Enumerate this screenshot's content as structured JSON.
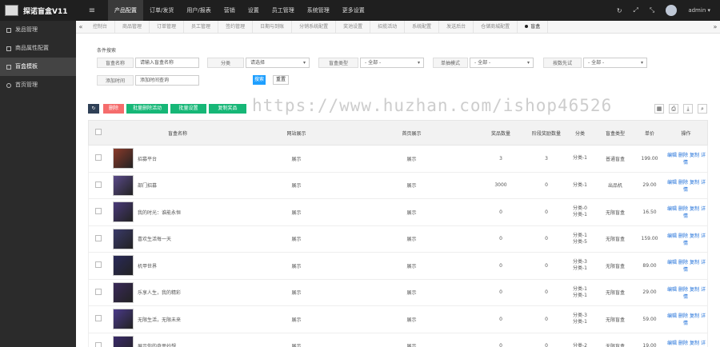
{
  "app": {
    "logo_text": "探诺盲盒V11"
  },
  "topnav": {
    "menu_toggle": "≡",
    "items": [
      "产品配置",
      "订单/发货",
      "用户/报表",
      "营销",
      "设置",
      "员工管理",
      "系统管理",
      "更多设置"
    ],
    "active_index": 0,
    "right_icons": {
      "refresh": "↻",
      "fullscreen_a": "⤢",
      "fullscreen_b": "⤡"
    },
    "user": "admin ▾"
  },
  "sidebar": {
    "items": [
      "发品管理",
      "商品属性配置",
      "盲盒模板",
      "首页管理"
    ],
    "active_index": 2
  },
  "tabs": {
    "left_arrow": "«",
    "right_arrow": "»",
    "items": [
      "控制台",
      "商品管理",
      "订单管理",
      "员工管理",
      "签约管理",
      "日期与到账",
      "分销系统配置",
      "奖池设置",
      "招揽活动",
      "系统配置",
      "发送后台",
      "仓储商城配置",
      "盲盒"
    ],
    "active_index": 12
  },
  "filter": {
    "title": "条件搜索",
    "fields": [
      {
        "label": "盲盒名称",
        "placeholder": "请输入盲盒名称"
      },
      {
        "label": "分类",
        "value": "请选择"
      },
      {
        "label": "盲盒类型",
        "value": "- 全部 -"
      },
      {
        "label": "单抽模式",
        "value": "- 全部 -"
      },
      {
        "label": "按数先试",
        "value": "- 全部 -"
      },
      {
        "label": "添加时间",
        "placeholder": "添加时间查询"
      }
    ],
    "search_label": "搜索",
    "reset_label": "重置"
  },
  "toolbar": {
    "refresh": "↻",
    "delete": "删除",
    "btn1": "批量删除活动",
    "btn2": "批量设置",
    "btn3": "复制奖品"
  },
  "tools": [
    "▦",
    "⎙",
    "⤓",
    "⌕"
  ],
  "table": {
    "headers": [
      "盲盒名称",
      "网站展示",
      "首页展示",
      "奖品数量",
      "阶段奖励数量",
      "分类",
      "盲盒类型",
      "单价",
      "操作"
    ],
    "rows": [
      {
        "name": "招募平台",
        "web": "展示",
        "front": "展示",
        "count": "3",
        "step": "3",
        "cat": [
          "分类-1"
        ],
        "type": "普通盲盒",
        "price": "199.00",
        "thumb": "#8b3a2a"
      },
      {
        "name": "部门招募",
        "web": "展示",
        "front": "展示",
        "count": "3000",
        "step": "0",
        "cat": [
          "分类-1"
        ],
        "type": "出品机",
        "price": "29.00",
        "thumb": "#5a4a8a"
      },
      {
        "name": "我的时光：谁能永恒",
        "web": "展示",
        "front": "展示",
        "count": "0",
        "step": "0",
        "cat": [
          "分类-0",
          "分类-1"
        ],
        "type": "无限盲盒",
        "price": "16.50",
        "thumb": "#4a3a7a"
      },
      {
        "name": "喜欢生活每一天",
        "web": "展示",
        "front": "展示",
        "count": "0",
        "step": "0",
        "cat": [
          "分类-1",
          "分类-5"
        ],
        "type": "无限盲盒",
        "price": "159.00",
        "thumb": "#3a3a6a"
      },
      {
        "name": "机甲世界",
        "web": "展示",
        "front": "展示",
        "count": "0",
        "step": "0",
        "cat": [
          "分类-3",
          "分类-1"
        ],
        "type": "无限盲盒",
        "price": "89.00",
        "thumb": "#2a2a5a"
      },
      {
        "name": "乐享人生，我的精彩",
        "web": "展示",
        "front": "展示",
        "count": "0",
        "step": "0",
        "cat": [
          "分类-1",
          "分类-1"
        ],
        "type": "无限盲盒",
        "price": "29.00",
        "thumb": "#3a2a5a"
      },
      {
        "name": "无限生活，无限未来",
        "web": "展示",
        "front": "展示",
        "count": "0",
        "step": "0",
        "cat": [
          "分类-3",
          "分类-1"
        ],
        "type": "无限盲盒",
        "price": "59.00",
        "thumb": "#4a3a8a"
      },
      {
        "name": "展示你的奇思妙想",
        "web": "展示",
        "front": "展示",
        "count": "0",
        "step": "0",
        "cat": [
          "分类-2"
        ],
        "type": "无限盲盒",
        "price": "19.00",
        "thumb": "#3a2a6a"
      }
    ],
    "ops": [
      "编辑",
      "删除",
      "复制",
      "详情"
    ]
  },
  "watermark": "https://www.huzhan.com/ishop46526"
}
